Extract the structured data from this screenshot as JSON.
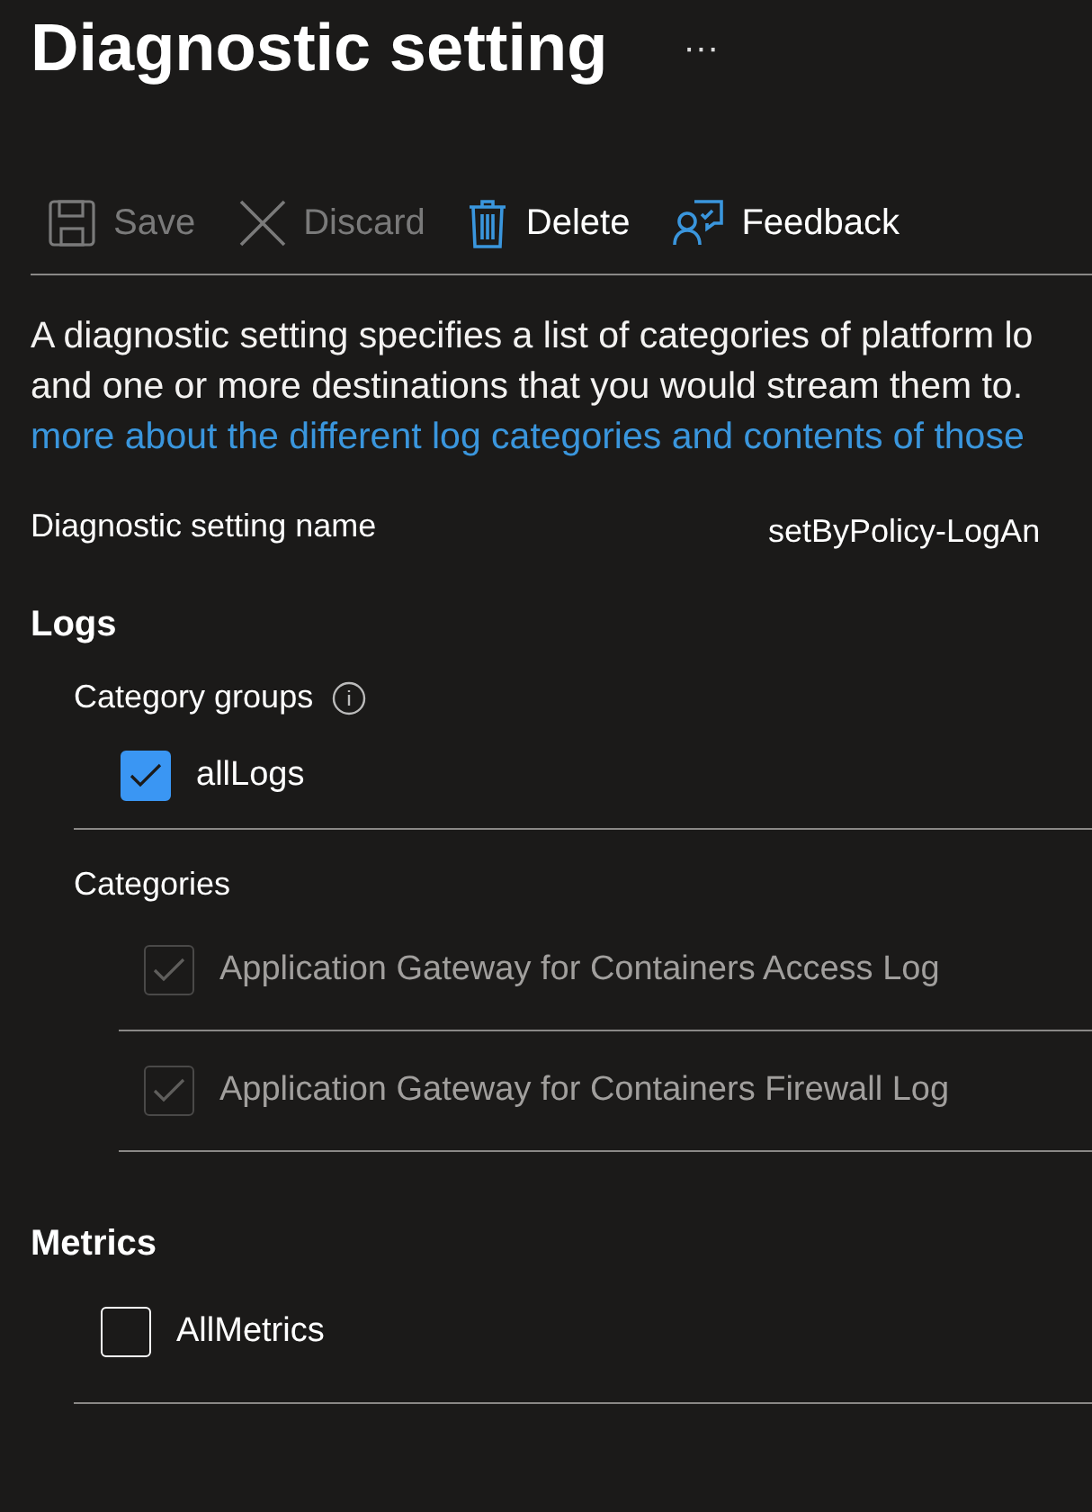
{
  "header": {
    "title": "Diagnostic setting",
    "more": "···"
  },
  "toolbar": [
    {
      "kind": "save",
      "label": "Save",
      "disabled": true
    },
    {
      "kind": "discard",
      "label": "Discard",
      "disabled": true
    },
    {
      "kind": "delete",
      "label": "Delete",
      "disabled": false
    },
    {
      "kind": "feedback",
      "label": "Feedback",
      "disabled": false
    }
  ],
  "description": {
    "lines": [
      "A diagnostic setting specifies a list of categories of platform lo",
      "and one or more destinations that you would stream them to."
    ],
    "link": "more about the different log categories and contents of those"
  },
  "name_field": {
    "label": "Diagnostic setting name",
    "value": "setByPolicy-LogAn"
  },
  "logs": {
    "title": "Logs",
    "groups_title": "Category groups",
    "groups": [
      {
        "label": "allLogs",
        "checked": true,
        "disabled": false
      }
    ],
    "categories_title": "Categories",
    "categories": [
      {
        "label": "Application Gateway for Containers Access Log",
        "checked": true,
        "disabled": true
      },
      {
        "label": "Application Gateway for Containers Firewall Log",
        "checked": true,
        "disabled": true
      }
    ]
  },
  "metrics": {
    "title": "Metrics",
    "items": [
      {
        "label": "AllMetrics",
        "checked": false,
        "disabled": false
      }
    ]
  }
}
